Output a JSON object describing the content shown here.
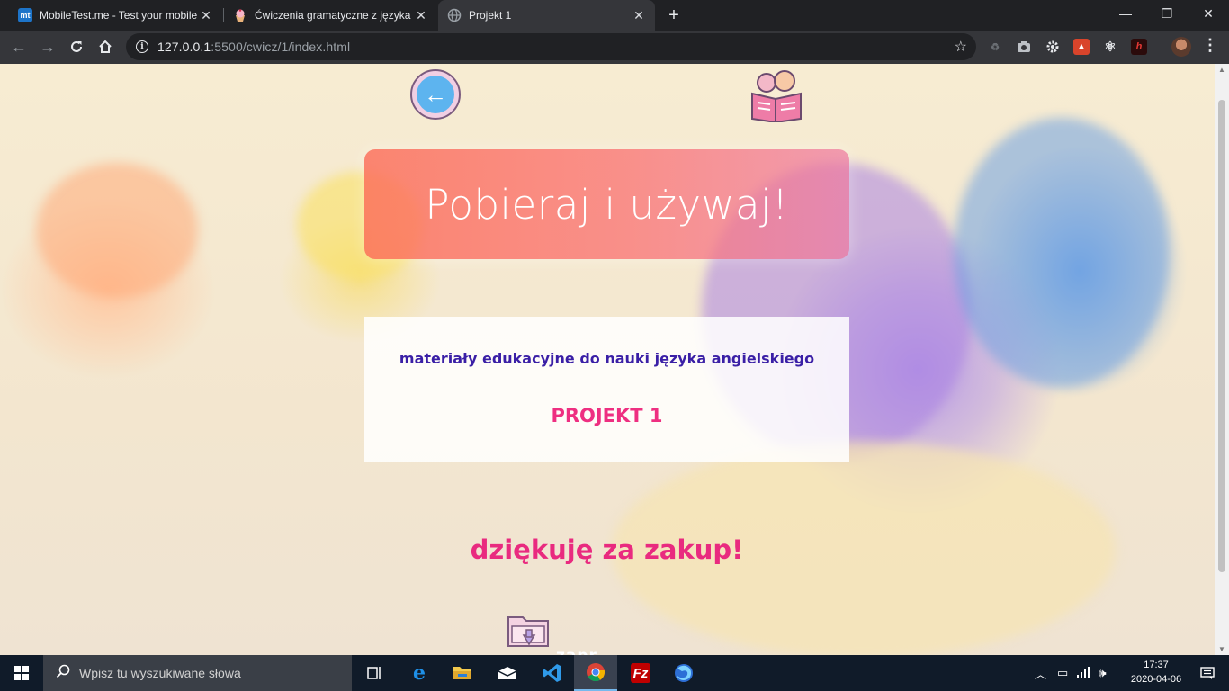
{
  "browser": {
    "tabs": [
      {
        "title": "MobileTest.me - Test your mobile",
        "favicon": "mt",
        "active": false
      },
      {
        "title": "Ćwiczenia gramatyczne z języka a",
        "favicon": "cupcake-icon",
        "active": false
      },
      {
        "title": "Projekt 1",
        "favicon": "globe-icon",
        "active": true
      }
    ],
    "new_tab_label": "+",
    "window_controls": {
      "minimize": "—",
      "restore": "❐",
      "close": "✕"
    },
    "address": {
      "host": "127.0.0.1",
      "rest": ":5500/cwicz/1/index.html"
    },
    "info_glyph": "i",
    "bookmark_glyph": "☆"
  },
  "page": {
    "title": "Pobieraj i używaj!",
    "subtitle": "materiały edukacyjne do nauki języka angielskiego",
    "project": "PROJEKT 1",
    "thanks": "dziękuję za zakup!",
    "partial_text": "zapr",
    "back_glyph": "←"
  },
  "taskbar": {
    "search_placeholder": "Wpisz tu wyszukiwane słowa",
    "time": "17:37",
    "date": "2020-04-06",
    "apps": [
      "task-view-icon",
      "edge-icon",
      "file-explorer-icon",
      "mail-icon",
      "vscode-icon",
      "chrome-icon",
      "filezilla-icon",
      "firefox-icon"
    ]
  },
  "colors": {
    "title_text": "#ffffff",
    "subtitle_text": "#3a1fa6",
    "project_text": "#ee2f81",
    "thanks_text": "#e92a7f",
    "back_button": "#5db4ef"
  }
}
